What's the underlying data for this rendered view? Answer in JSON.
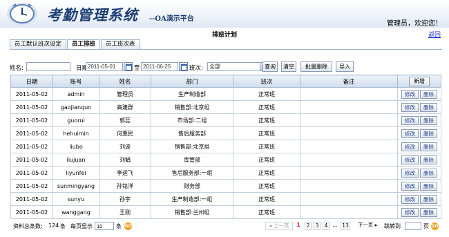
{
  "header": {
    "title": "考勤管理系统",
    "subtitle": "--OA演示平台",
    "welcome": "管理员，欢迎您！"
  },
  "page": {
    "title": "排班计划",
    "back": "返回"
  },
  "tabs": [
    {
      "label": "员工默认班次设定",
      "active": false
    },
    {
      "label": "员工排班",
      "active": true
    },
    {
      "label": "员工班次表",
      "active": false
    }
  ],
  "filter": {
    "name_label": "姓名:",
    "name_value": "",
    "date_label": "日期:",
    "date_from": "2011-05-01",
    "to_label": "至",
    "date_to": "2011-06-25",
    "shift_label": "班次:",
    "shift_value": "全部",
    "btn_query": "查询",
    "btn_clear": "清空",
    "btn_batch_delete": "批量删除",
    "btn_import": "导入"
  },
  "table": {
    "columns": [
      "日期",
      "账号",
      "姓名",
      "部门",
      "班次",
      "备注"
    ],
    "add_label": "新增",
    "edit_label": "修改",
    "delete_label": "删除",
    "rows": [
      {
        "date": "2011-05-02",
        "account": "admin",
        "name": "管理员",
        "dept": "生产制造部",
        "shift": "正常班",
        "note": ""
      },
      {
        "date": "2011-05-02",
        "account": "gaojianqun",
        "name": "高建群",
        "dept": "销售部:北京组",
        "shift": "正常班",
        "note": ""
      },
      {
        "date": "2011-05-02",
        "account": "guorui",
        "name": "郭蕊",
        "dept": "市场部:二组",
        "shift": "正常班",
        "note": ""
      },
      {
        "date": "2011-05-02",
        "account": "hehuimin",
        "name": "何惠民",
        "dept": "售后服务部",
        "shift": "正常班",
        "note": ""
      },
      {
        "date": "2011-05-02",
        "account": "liubo",
        "name": "刘波",
        "dept": "销售部:北京组",
        "shift": "正常班",
        "note": ""
      },
      {
        "date": "2011-05-02",
        "account": "liujuan",
        "name": "刘娟",
        "dept": "库管部",
        "shift": "正常班",
        "note": ""
      },
      {
        "date": "2011-05-02",
        "account": "liyunfei",
        "name": "李运飞",
        "dept": "售后服务部:一组",
        "shift": "正常班",
        "note": ""
      },
      {
        "date": "2011-05-02",
        "account": "sunmingyang",
        "name": "孙铭洋",
        "dept": "财务部",
        "shift": "正常班",
        "note": ""
      },
      {
        "date": "2011-05-02",
        "account": "sunyu",
        "name": "孙宇",
        "dept": "生产制造部:一组",
        "shift": "正常班",
        "note": ""
      },
      {
        "date": "2011-05-02",
        "account": "wanggang",
        "name": "王刚",
        "dept": "销售部:兰州组",
        "shift": "正常班",
        "note": ""
      }
    ]
  },
  "footer": {
    "total_label": "资料总条数:",
    "total_value": "124",
    "total_unit": "条",
    "per_page_label": "每页显示",
    "per_page_value": "10",
    "per_page_unit": "条",
    "go_label": "GO",
    "prev": "上一页",
    "pages": [
      "1",
      "2",
      "3",
      "4",
      "...",
      "13"
    ],
    "current_page": "1",
    "next": "下一页",
    "jump_label": "跳转到",
    "jump_value": "",
    "jump_unit": "页"
  }
}
